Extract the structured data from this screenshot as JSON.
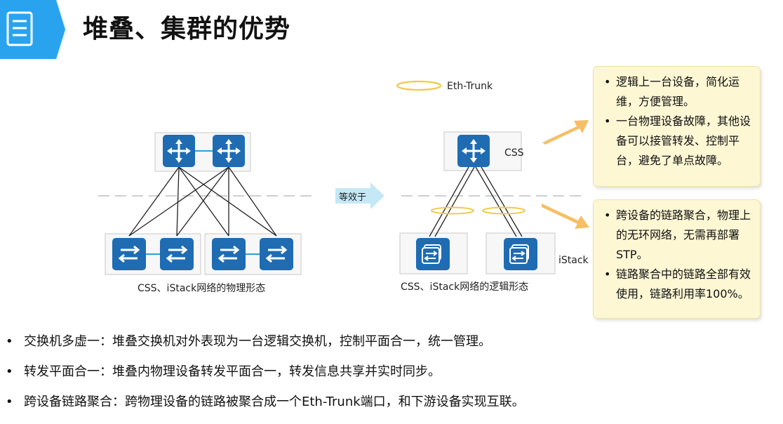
{
  "header": {
    "title": "堆叠、集群的优势",
    "band_color": "#2aa3ee"
  },
  "diagram": {
    "legend_label": "Eth-Trunk",
    "equivalent_label": "等效于",
    "physical_caption": "CSS、iStack网络的物理形态",
    "logical_caption": "CSS、iStack网络的逻辑形态",
    "css_label": "CSS",
    "istack_label": "iStack",
    "device_color": "#1f6cb3",
    "ring_color": "#f0c94a"
  },
  "callouts": [
    {
      "items": [
        "逻辑上一台设备，简化运维，方便管理。",
        "一台物理设备故障，其他设备可以接管转发、控制平台，避免了单点故障。"
      ]
    },
    {
      "items": [
        "跨设备的链路聚合，物理上的无环网络，无需再部署STP。",
        "链路聚合中的链路全部有效使用，链路利用率100%。"
      ]
    }
  ],
  "bullets": [
    "交换机多虚一：堆叠交换机对外表现为一台逻辑交换机，控制平面合一，统一管理。",
    "转发平面合一：堆叠内物理设备转发平面合一，转发信息共享并实时同步。",
    "跨设备链路聚合：跨物理设备的链路被聚合成一个Eth-Trunk端口，和下游设备实现互联。"
  ]
}
